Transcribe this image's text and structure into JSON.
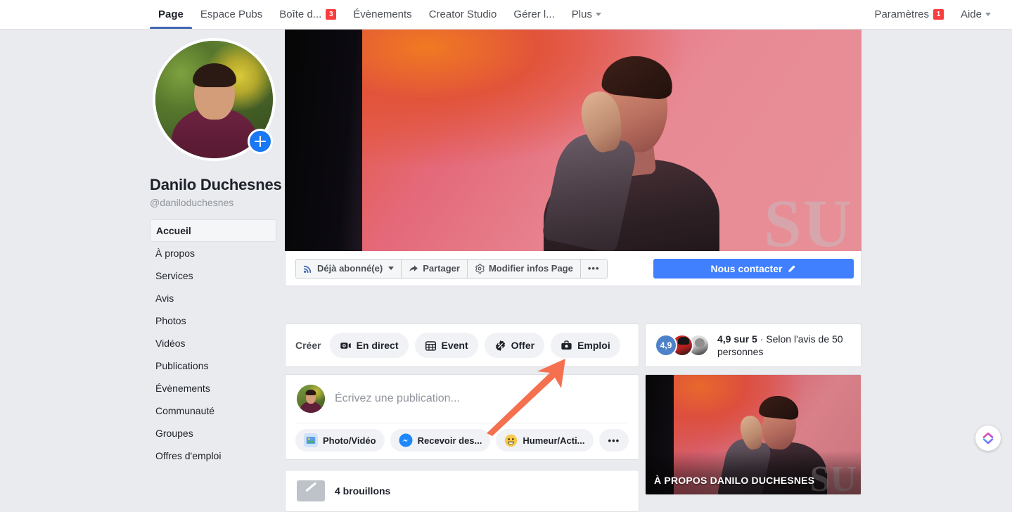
{
  "topnav": {
    "items": [
      {
        "label": "Page",
        "active": true,
        "badge": null,
        "caret": false
      },
      {
        "label": "Espace Pubs",
        "active": false,
        "badge": null,
        "caret": false
      },
      {
        "label": "Boîte d...",
        "active": false,
        "badge": "3",
        "caret": false
      },
      {
        "label": "Évènements",
        "active": false,
        "badge": null,
        "caret": false
      },
      {
        "label": "Creator Studio",
        "active": false,
        "badge": null,
        "caret": false
      },
      {
        "label": "Gérer l...",
        "active": false,
        "badge": null,
        "caret": false
      },
      {
        "label": "Plus",
        "active": false,
        "badge": null,
        "caret": true
      }
    ],
    "right_items": [
      {
        "label": "Paramètres",
        "badge": "1",
        "caret": false
      },
      {
        "label": "Aide",
        "badge": null,
        "caret": true
      }
    ]
  },
  "profile": {
    "name": "Danilo Duchesnes",
    "handle": "@daniloduchesnes",
    "add_photo_icon": "plus-icon"
  },
  "sidebar": {
    "items": [
      {
        "label": "Accueil",
        "active": true
      },
      {
        "label": "À propos",
        "active": false
      },
      {
        "label": "Services",
        "active": false
      },
      {
        "label": "Avis",
        "active": false
      },
      {
        "label": "Photos",
        "active": false
      },
      {
        "label": "Vidéos",
        "active": false
      },
      {
        "label": "Publications",
        "active": false
      },
      {
        "label": "Évènements",
        "active": false
      },
      {
        "label": "Communauté",
        "active": false
      },
      {
        "label": "Groupes",
        "active": false
      },
      {
        "label": "Offres d'emploi",
        "active": false
      }
    ]
  },
  "action_bar": {
    "buttons": [
      {
        "label": "Déjà abonné(e)",
        "icon": "rss-icon",
        "caret": true
      },
      {
        "label": "Partager",
        "icon": "share-arrow-icon",
        "caret": false
      },
      {
        "label": "Modifier infos Page",
        "icon": "gear-icon",
        "caret": false
      },
      {
        "label": "•••",
        "icon": "ellipsis-icon",
        "caret": false
      }
    ],
    "primary": {
      "label": "Nous contacter",
      "icon": "pencil-icon",
      "color": "#4080ff"
    }
  },
  "create_row": {
    "label": "Créer",
    "buttons": [
      {
        "label": "En direct",
        "icon": "video-camera-icon"
      },
      {
        "label": "Event",
        "icon": "calendar-icon"
      },
      {
        "label": "Offer",
        "icon": "percent-badge-icon"
      },
      {
        "label": "Emploi",
        "icon": "briefcase-icon"
      }
    ]
  },
  "composer": {
    "placeholder": "Écrivez une publication...",
    "avatar": "user-avatar",
    "actions": [
      {
        "label": "Photo/Vidéo",
        "icon": "photo-icon"
      },
      {
        "label": "Recevoir des...",
        "icon": "messenger-icon"
      },
      {
        "label": "Humeur/Acti...",
        "icon": "smiley-icon"
      },
      {
        "label": "•••",
        "icon": "ellipsis-icon"
      }
    ]
  },
  "drafts": {
    "label": "4 brouillons",
    "icon": "draft-pencil-icon"
  },
  "rating_card": {
    "score": "4,9",
    "headline": "4,9 sur 5",
    "detail": " · Selon l'avis de 50 personnes",
    "avatars": [
      "reviewer-avatar-1",
      "reviewer-avatar-2"
    ]
  },
  "about_card": {
    "title": "À PROPOS DANILO DUCHESNES",
    "cover_text": "SU"
  },
  "cover": {
    "text": "SU"
  },
  "annotation": {
    "type": "arrow",
    "color": "#F4704E",
    "points_to": "Emploi"
  },
  "float_widget": {
    "icon": "chevron-stack-icon"
  },
  "colors": {
    "page_bg": "#e9ebee",
    "card_bg": "#ffffff",
    "border": "#dddfe2",
    "accent_blue": "#4267b2",
    "primary_blue": "#4080ff",
    "badge_red": "#fa3e3e",
    "text_dark": "#1d2129",
    "text_muted": "#90949c",
    "annotation_orange": "#F4704E"
  }
}
